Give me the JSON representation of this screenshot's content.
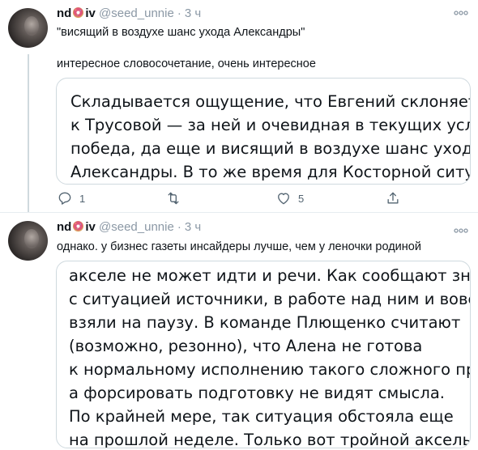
{
  "tweets": [
    {
      "name_start": "nd",
      "name_end": "iv",
      "handle": "@seed_unnie",
      "separator": "·",
      "time": "3 ч",
      "text1": "\"висящий в воздухе шанс ухода Александры\"",
      "text2": "интересное словосочетание, очень интересное",
      "quote_lines": [
        "Складывается ощущение, что Евгений склоняется",
        "к Трусовой — за ней и очевидная в текущих условиях",
        "победа, да еще и висящий в воздухе шанс ухода",
        "Александры. В то же время для Косторной ситуация"
      ],
      "replies": "1",
      "retweets": "",
      "likes": "5"
    },
    {
      "name_start": "nd",
      "name_end": "iv",
      "handle": "@seed_unnie",
      "separator": "·",
      "time": "3 ч",
      "text1": "однако. у бизнес газеты инсайдеры лучше, чем у леночки родиной",
      "quote_lines": [
        "акселе не может идти и речи. Как сообщают знакомые",
        "с ситуацией источники, в работе над ним и вовсе пока",
        "взяли на паузу. В команде Плющенко считают",
        "(возможно, резонно), что Алена не готова",
        "к нормальному исполнению такого сложного прыжка,",
        "а форсировать подготовку не видят смысла.",
        "По крайней мере, так ситуация обстояла еще",
        "на прошлой неделе. Только вот тройной аксель — это"
      ]
    }
  ],
  "icons": {
    "more": "more-horizontal-icon",
    "reply": "reply-icon",
    "retweet": "retweet-icon",
    "like": "heart-icon",
    "share": "share-icon",
    "donut": "donut-emoji-icon"
  },
  "colors": {
    "text": "#0f1419",
    "muted": "#8b98a5",
    "border": "#cfd9de",
    "action": "#536471"
  }
}
